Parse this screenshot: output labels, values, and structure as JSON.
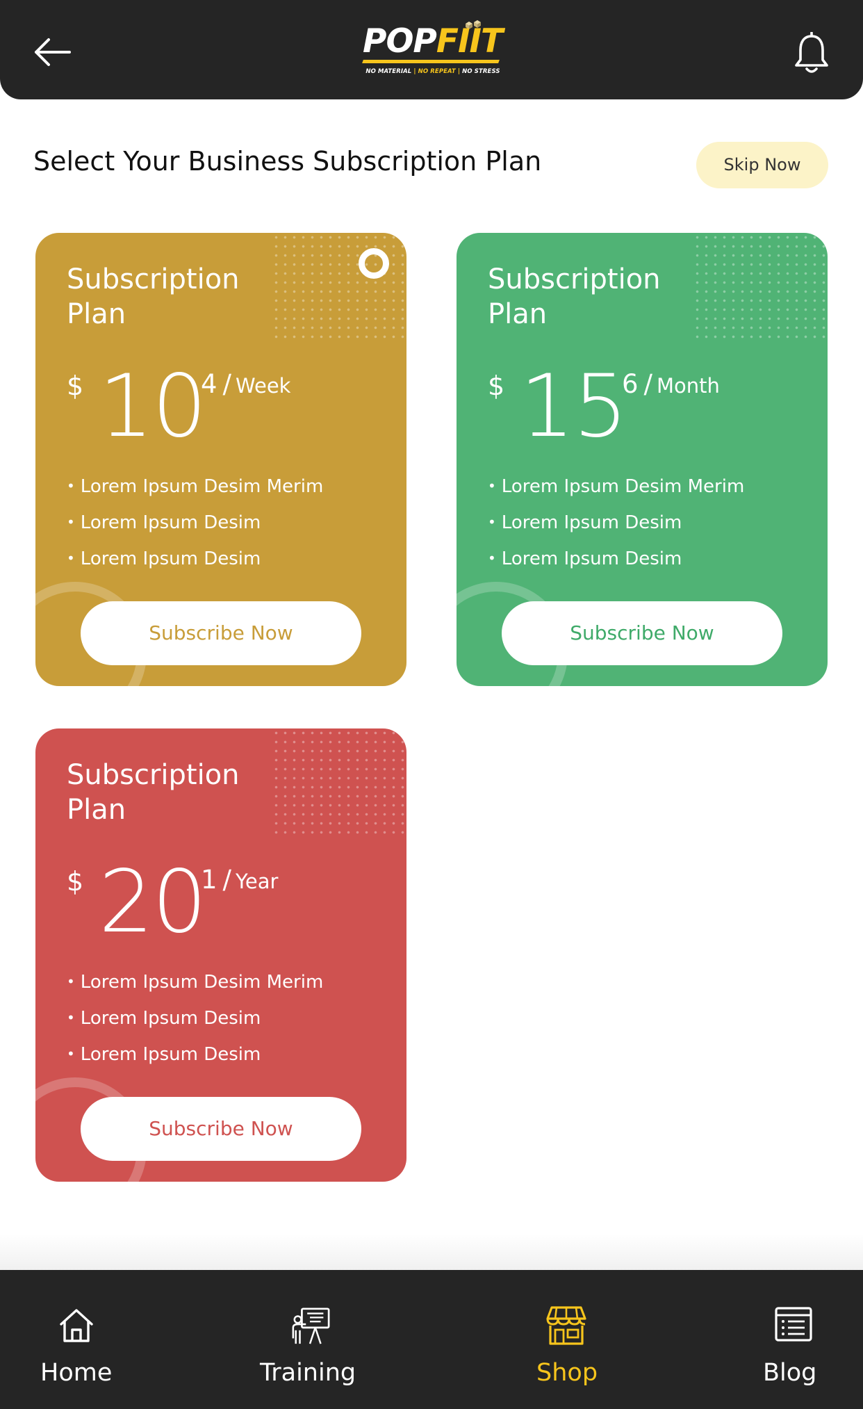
{
  "header": {
    "logo": {
      "brand_part1": "POP",
      "brand_part2": "FIIT",
      "tag1": "NO MATERIAL",
      "tag2": "NO REPEAT",
      "tag3": "NO STRESS",
      "divider": "|"
    },
    "icons": {
      "back": "arrow-left-icon",
      "notifications": "bell-icon"
    }
  },
  "page": {
    "title": "Select Your Business Subscription Plan",
    "skip_label": "Skip Now"
  },
  "plans": [
    {
      "name": "Subscription Plan",
      "currency": "$",
      "amount": "10",
      "amount_sup": "4",
      "separator": "/",
      "period": "Week",
      "features": [
        "Lorem Ipsum Desim Merim",
        "Lorem Ipsum Desim",
        "Lorem Ipsum Desim"
      ],
      "button_label": "Subscribe Now",
      "color": "#c89d39"
    },
    {
      "name": "Subscription Plan",
      "currency": "$",
      "amount": "15",
      "amount_sup": "6",
      "separator": "/",
      "period": "Month",
      "features": [
        "Lorem Ipsum Desim Merim",
        "Lorem Ipsum Desim",
        "Lorem Ipsum Desim"
      ],
      "button_label": "Subscribe Now",
      "color": "#50b375"
    },
    {
      "name": "Subscription Plan",
      "currency": "$",
      "amount": "20",
      "amount_sup": "1",
      "separator": "/",
      "period": "Year",
      "features": [
        "Lorem Ipsum Desim Merim",
        "Lorem Ipsum Desim",
        "Lorem Ipsum Desim"
      ],
      "button_label": "Subscribe Now",
      "color": "#cf5250"
    }
  ],
  "tabbar": {
    "items": [
      {
        "label": "Home",
        "icon": "home-icon",
        "active": false
      },
      {
        "label": "Training",
        "icon": "training-board-icon",
        "active": false
      },
      {
        "label": "Shop",
        "icon": "shop-icon",
        "active": true
      },
      {
        "label": "Blog",
        "icon": "blog-list-icon",
        "active": false
      }
    ]
  },
  "colors": {
    "header_bg": "#252525",
    "accent_yellow": "#f7c51c",
    "skip_bg": "#fcf3c8"
  }
}
